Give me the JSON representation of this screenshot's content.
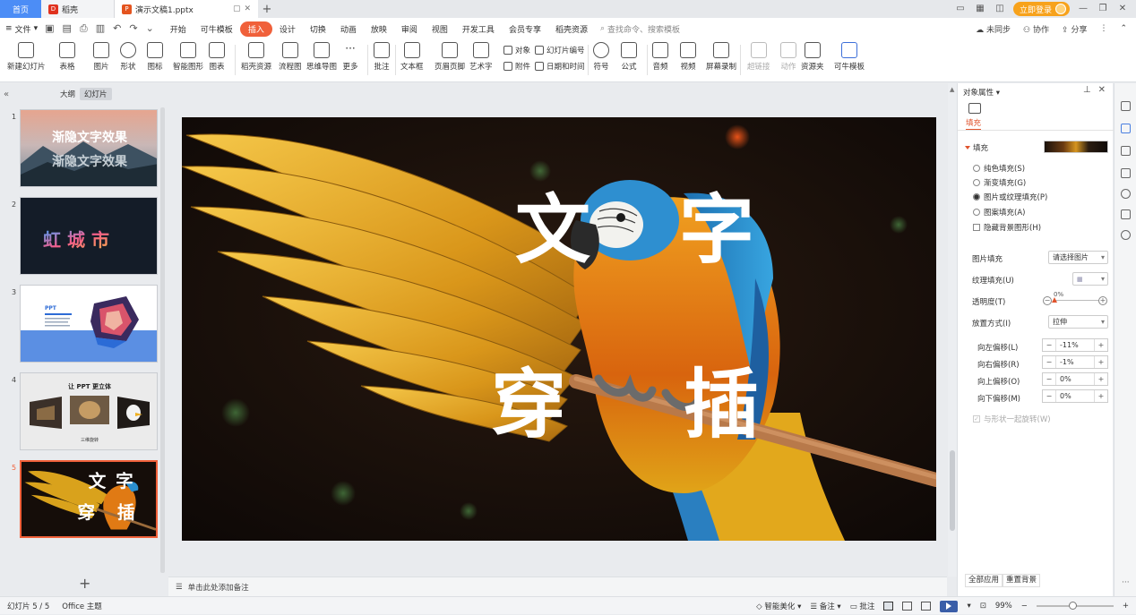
{
  "titlebar": {
    "home_tab": "首页",
    "tabs": [
      {
        "label": "稻壳"
      },
      {
        "label": "演示文稿1.pptx"
      }
    ],
    "add_tab": "+",
    "login_button": "立即登录"
  },
  "menubar": {
    "file_label": "文件",
    "items": [
      "开始",
      "可牛模板",
      "插入",
      "设计",
      "切换",
      "动画",
      "放映",
      "审阅",
      "视图",
      "开发工具",
      "会员专享",
      "稻壳资源"
    ],
    "active_item": "插入",
    "search_placeholder": "查找命令、搜索模板",
    "sync": "未同步",
    "collab": "协作",
    "share": "分享"
  },
  "ribbon": {
    "buttons": [
      "新建幻灯片",
      "表格",
      "图片",
      "形状",
      "图标",
      "智能图形",
      "图表",
      "稻壳资源",
      "流程图",
      "思维导图",
      "更多",
      "批注",
      "文本框",
      "页眉页脚",
      "艺术字",
      "符号",
      "公式",
      "音频",
      "视频",
      "屏幕录制",
      "超链接",
      "动作",
      "资源夹",
      "可牛模板"
    ],
    "small": {
      "object": "对象",
      "attachment": "附件",
      "slide_number": "幻灯片编号",
      "datetime": "日期和时间"
    }
  },
  "left_pane": {
    "tab_outline": "大纲",
    "tab_slides": "幻灯片",
    "thumbs": [
      {
        "num": "1",
        "title1": "渐隐文字效果",
        "title2": "渐隐文字效果"
      },
      {
        "num": "2",
        "title": "虹 城 市"
      },
      {
        "num": "3",
        "label": "PPT"
      },
      {
        "num": "4",
        "title": "让 PPT 更立体",
        "caption": "三维旋转"
      },
      {
        "num": "5",
        "w1": "文",
        "w2": "字",
        "w3": "穿",
        "w4": "插"
      }
    ],
    "add_button": "+"
  },
  "slide": {
    "char_wen": "文",
    "char_zi": "字",
    "char_chuan": "穿",
    "char_cha": "插"
  },
  "notes_placeholder": "单击此处添加备注",
  "right_panel": {
    "title": "对象属性",
    "fill_tab": "填充",
    "fill_section": "填充",
    "options": [
      "纯色填充(S)",
      "渐变填充(G)",
      "图片或纹理填充(P)",
      "图案填充(A)"
    ],
    "selected_option": "图片或纹理填充(P)",
    "hide_bg": "隐藏背景图形(H)",
    "picture_fill_label": "图片填充",
    "picture_fill_value": "请选择图片",
    "texture_label": "纹理填充(U)",
    "transparency_label": "透明度(T)",
    "transparency_value": "0%",
    "transparency_fraction": 0,
    "placement_label": "放置方式(I)",
    "placement_value": "拉伸",
    "offsets": [
      {
        "label": "向左偏移(L)",
        "value": "-11%"
      },
      {
        "label": "向右偏移(R)",
        "value": "-1%"
      },
      {
        "label": "向上偏移(O)",
        "value": "0%"
      },
      {
        "label": "向下偏移(M)",
        "value": "0%"
      }
    ],
    "rotate_with_shape": "与形状一起旋转(W)",
    "apply_all": "全部应用",
    "reset_bg": "重置背景"
  },
  "statusbar": {
    "slide_info": "幻灯片 5 / 5",
    "theme": "Office 主题",
    "smart_beautify": "智能美化",
    "notes": "备注",
    "comments": "批注",
    "zoom": "99%",
    "zoom_fraction": 0.46
  },
  "colors": {
    "accent": "#f0603a",
    "home_tab": "#4c8df6",
    "login": "#f7a21b",
    "play": "#3a5ea8"
  }
}
